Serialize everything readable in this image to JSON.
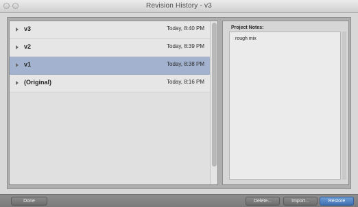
{
  "window": {
    "title": "Revision History - v3"
  },
  "revisions": [
    {
      "name": "v3",
      "time": "Today, 8:40 PM",
      "selected": false
    },
    {
      "name": "v2",
      "time": "Today, 8:39 PM",
      "selected": false
    },
    {
      "name": "v1",
      "time": "Today, 8:38 PM",
      "selected": true
    },
    {
      "name": "(Original)",
      "time": "Today, 8:16 PM",
      "selected": false
    }
  ],
  "notes": {
    "label": "Project Notes:",
    "text": "rough mix"
  },
  "buttons": {
    "done": "Done",
    "delete": "Delete...",
    "import": "Import...",
    "restore": "Restore"
  },
  "colors": {
    "selection": "#a3b3cf",
    "restore_accent": "#4f80c2"
  }
}
